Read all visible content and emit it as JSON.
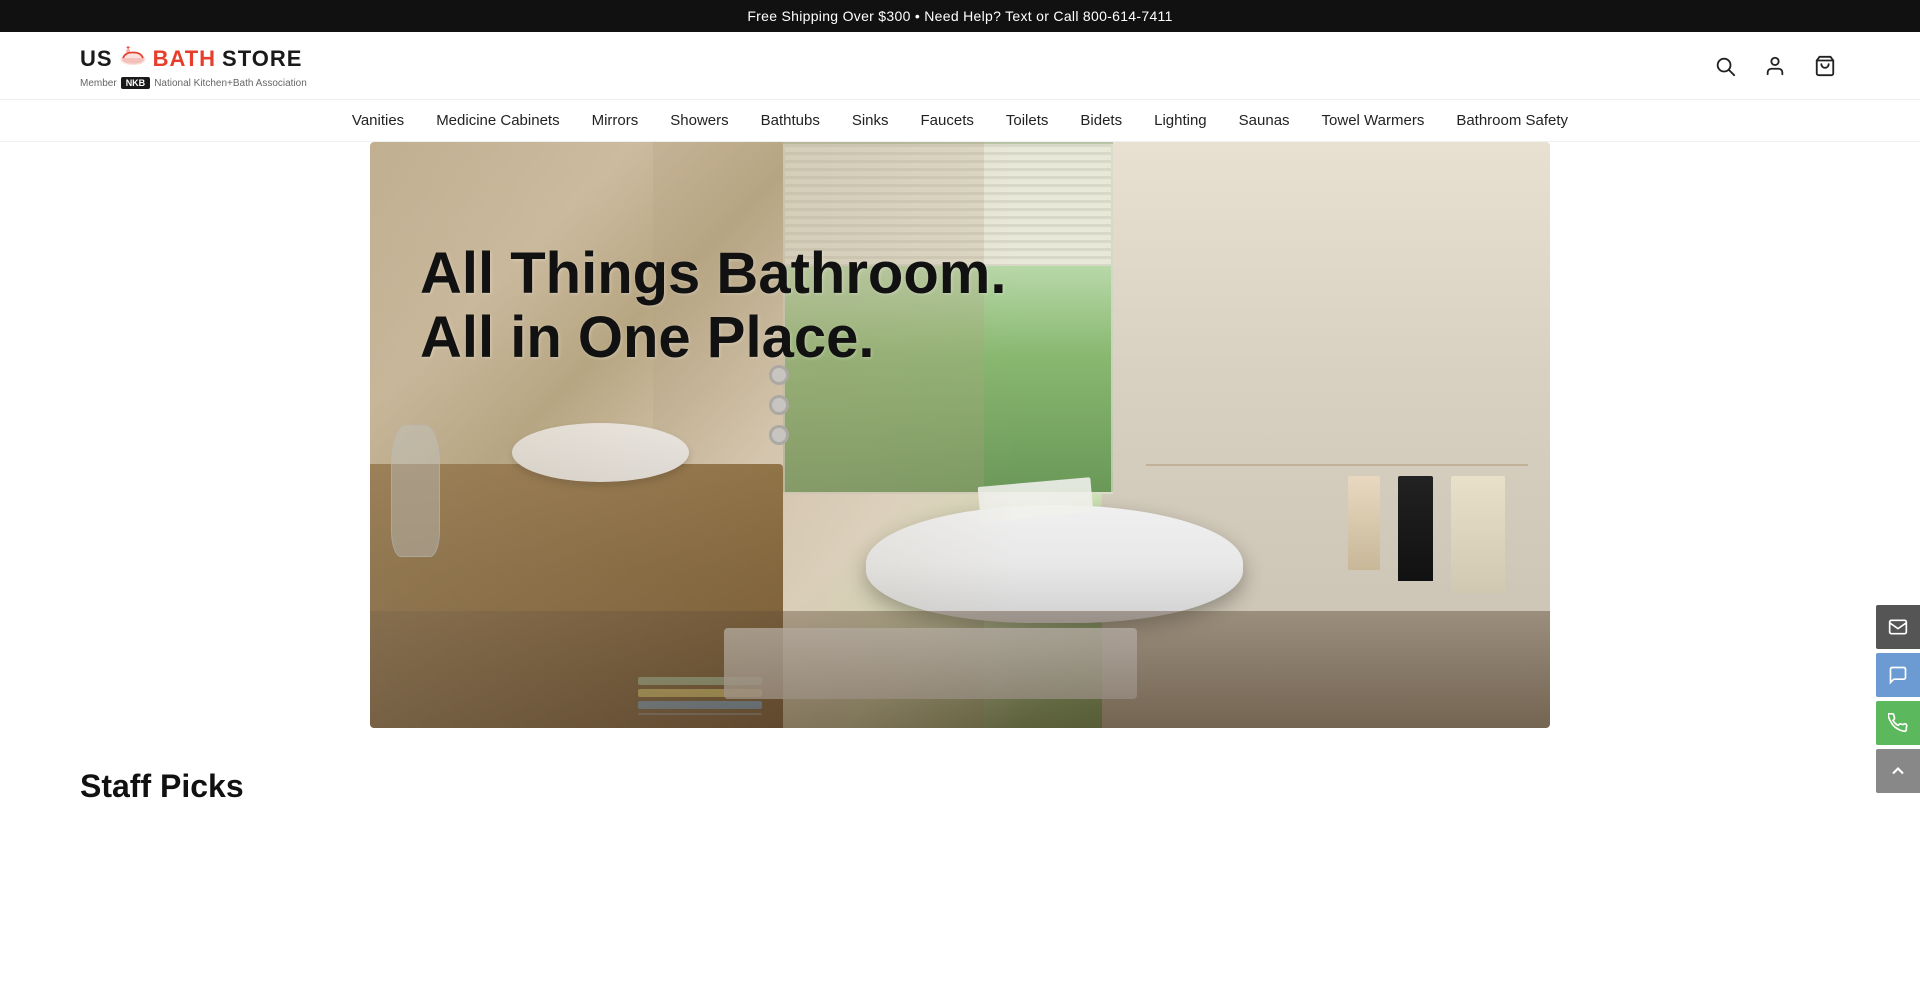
{
  "announcement": {
    "text": "Free Shipping Over $300 • Need Help? Text or Call 800-614-7411"
  },
  "header": {
    "logo": {
      "text_us": "US",
      "icon": "🛁",
      "text_bath": "BATH",
      "text_store": "STORE",
      "member_text": "Member",
      "member_badge": "NKB",
      "member_full": "National Kitchen+Bath Association"
    },
    "icons": {
      "search": "🔍",
      "account": "👤",
      "cart": "🛒"
    }
  },
  "nav": {
    "items": [
      {
        "label": "Vanities",
        "id": "vanities"
      },
      {
        "label": "Medicine Cabinets",
        "id": "medicine-cabinets"
      },
      {
        "label": "Mirrors",
        "id": "mirrors"
      },
      {
        "label": "Showers",
        "id": "showers"
      },
      {
        "label": "Bathtubs",
        "id": "bathtubs"
      },
      {
        "label": "Sinks",
        "id": "sinks"
      },
      {
        "label": "Faucets",
        "id": "faucets"
      },
      {
        "label": "Toilets",
        "id": "toilets"
      },
      {
        "label": "Bidets",
        "id": "bidets"
      },
      {
        "label": "Lighting",
        "id": "lighting"
      },
      {
        "label": "Saunas",
        "id": "saunas"
      },
      {
        "label": "Towel Warmers",
        "id": "towel-warmers"
      },
      {
        "label": "Bathroom Safety",
        "id": "bathroom-safety"
      }
    ]
  },
  "hero": {
    "headline_line1": "All Things Bathroom.",
    "headline_line2": "All in One Place."
  },
  "staff_picks": {
    "title": "Staff Picks"
  },
  "float_buttons": {
    "email_label": "✉",
    "sms_label": "💬",
    "phone_label": "📞",
    "top_label": "↑"
  }
}
